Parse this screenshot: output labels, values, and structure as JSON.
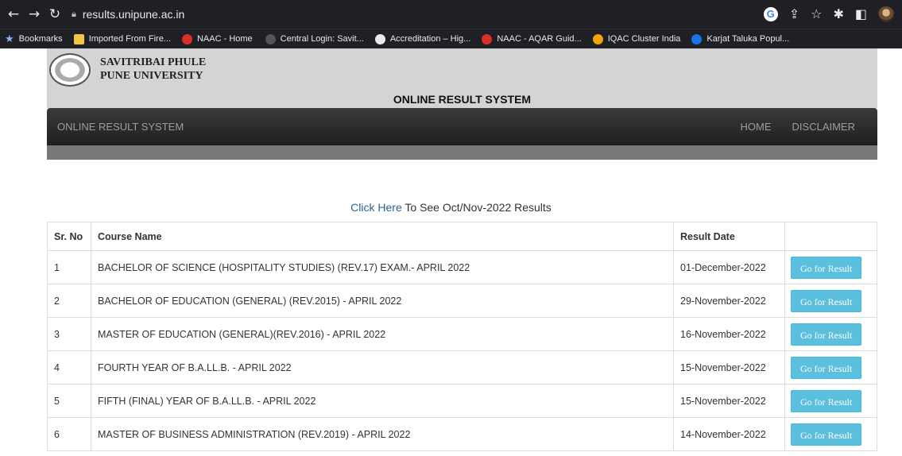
{
  "browser": {
    "url": "results.unipune.ac.in",
    "bookmarks": [
      {
        "label": "Bookmarks",
        "icon": "star-icon"
      },
      {
        "label": "Imported From Fire...",
        "icon": "folder-icon"
      },
      {
        "label": "NAAC - Home",
        "icon": "naac-icon"
      },
      {
        "label": "Central Login: Savit...",
        "icon": "site-icon"
      },
      {
        "label": "Accreditation – Hig...",
        "icon": "globe-icon"
      },
      {
        "label": "NAAC - AQAR Guid...",
        "icon": "naac-icon"
      },
      {
        "label": "IQAC Cluster India",
        "icon": "iqac-icon"
      },
      {
        "label": "Karjat Taluka Popul...",
        "icon": "site-icon"
      }
    ]
  },
  "header": {
    "uni_line1": "SAVITRIBAI PHULE",
    "uni_line2": "PUNE UNIVERSITY",
    "system_title": "ONLINE RESULT SYSTEM"
  },
  "navbar": {
    "brand": "ONLINE RESULT SYSTEM",
    "home": "HOME",
    "disclaimer": "DISCLAIMER"
  },
  "notice": {
    "link_text": "Click Here",
    "rest_text": " To See Oct/Nov-2022 Results"
  },
  "table": {
    "headers": [
      "Sr. No",
      "Course Name",
      "Result Date",
      ""
    ],
    "button_label": "Go for Result",
    "rows": [
      {
        "sr": "1",
        "course": "BACHELOR OF SCIENCE (HOSPITALITY STUDIES) (REV.17) EXAM.- APRIL 2022",
        "date": "01-December-2022"
      },
      {
        "sr": "2",
        "course": "BACHELOR OF EDUCATION (GENERAL) (REV.2015) - APRIL 2022",
        "date": "29-November-2022"
      },
      {
        "sr": "3",
        "course": "MASTER OF EDUCATION (GENERAL)(REV.2016) - APRIL 2022",
        "date": "16-November-2022"
      },
      {
        "sr": "4",
        "course": "FOURTH YEAR OF B.A.LL.B. - APRIL 2022",
        "date": "15-November-2022"
      },
      {
        "sr": "5",
        "course": "FIFTH (FINAL) YEAR OF B.A.LL.B. - APRIL 2022",
        "date": "15-November-2022"
      },
      {
        "sr": "6",
        "course": "MASTER OF BUSINESS ADMINISTRATION (REV.2019) - APRIL 2022",
        "date": "14-November-2022"
      }
    ]
  },
  "colors": {
    "button": "#5bc0de",
    "link": "#2a6496",
    "navbar": "#222222"
  }
}
